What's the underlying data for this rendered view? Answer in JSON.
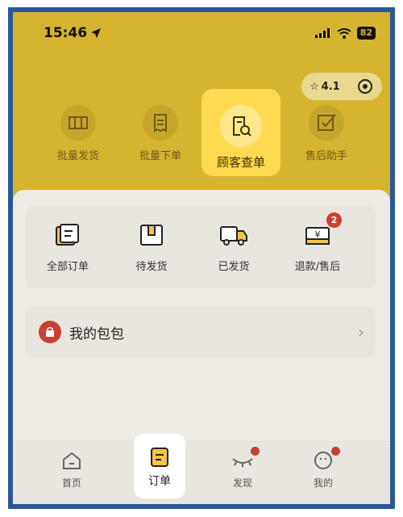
{
  "status_bar": {
    "time": "15:46",
    "battery": "82"
  },
  "capsule": {
    "rating": "4.1"
  },
  "shortcuts": [
    {
      "label": "批量发货"
    },
    {
      "label": "批量下单"
    },
    {
      "label": "顾客查单"
    },
    {
      "label": "售后助手"
    }
  ],
  "orders": [
    {
      "label": "全部订单"
    },
    {
      "label": "待发货"
    },
    {
      "label": "已发货"
    },
    {
      "label": "退款/售后",
      "badge": "2"
    }
  ],
  "bag": {
    "label": "我的包包"
  },
  "tabbar": [
    {
      "label": "首页"
    },
    {
      "label": "订单"
    },
    {
      "label": "发现"
    },
    {
      "label": "我的"
    }
  ],
  "colors": {
    "accent": "#d6b42f",
    "highlight": "#ffd94f",
    "badge": "#c94031",
    "frame": "#2b5797"
  }
}
